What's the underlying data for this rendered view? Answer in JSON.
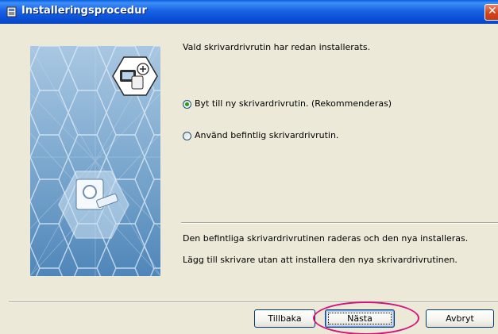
{
  "window": {
    "title": "Installeringsprocedur",
    "title_icon": "installer-icon",
    "close_icon": "close-icon",
    "close_glyph": "✕"
  },
  "main": {
    "intro_text": "Vald skrivardrivrutin har redan installerats.",
    "options": [
      {
        "label": "Byt till ny skrivardrivrutin. (Rekommenderas)",
        "checked": true
      },
      {
        "label": "Använd befintlig skrivardrivrutin.",
        "checked": false
      }
    ],
    "descriptions": [
      "Den befintliga skrivardrivrutinen raderas och den nya installeras.",
      "Lägg till skrivare utan att installera den nya skrivardrivrutinen."
    ]
  },
  "buttons": {
    "back": "Tillbaka",
    "next": "Nästa",
    "cancel": "Avbryt"
  },
  "colors": {
    "titlebar": "#0a4fd6",
    "dialog_bg": "#ece9d8",
    "highlight": "#d2167e",
    "art_bg": "#7da9cf"
  }
}
